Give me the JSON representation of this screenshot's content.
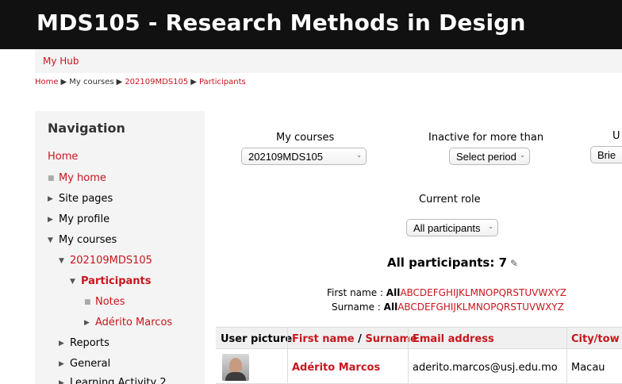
{
  "header": {
    "title": "MDS105 - Research Methods in Design"
  },
  "navbar": {
    "my_hub": "My Hub"
  },
  "breadcrumb": {
    "items": [
      "Home",
      "My courses",
      "202109MDS105",
      "Participants"
    ],
    "separator": "▶"
  },
  "navigation": {
    "title": "Navigation",
    "items": [
      {
        "label": "Home"
      },
      {
        "label": "My home"
      },
      {
        "label": "Site pages"
      },
      {
        "label": "My profile"
      },
      {
        "label": "My courses"
      },
      {
        "label": "202109MDS105"
      },
      {
        "label": "Participants"
      },
      {
        "label": "Notes"
      },
      {
        "label": "Adérito Marcos"
      },
      {
        "label": "Reports"
      },
      {
        "label": "General"
      },
      {
        "label": "Learning Activity 2"
      }
    ]
  },
  "filters": {
    "my_courses_label": "My courses",
    "my_courses_value": "202109MDS105",
    "inactive_label": "Inactive for more than",
    "inactive_value": "Select period",
    "third_label": "U",
    "third_value": "Brie",
    "role_label": "Current role",
    "role_value": "All participants"
  },
  "participants_heading": "All participants: 7",
  "initials": {
    "first_name_label": "First name :",
    "surname_label": "Surname :",
    "all": "All",
    "letters": "ABCDEFGHIJKLMNOPQRSTUVWXYZ"
  },
  "table": {
    "headers": {
      "user_picture": "User picture",
      "first_name": "First name",
      "slash": " / ",
      "surname": "Surname",
      "email": "Email address",
      "city": "City/tow"
    },
    "rows": [
      {
        "name": "Adérito Marcos",
        "email": "aderito.marcos@usj.edu.mo",
        "city": "Macau"
      }
    ]
  },
  "colors": {
    "accent": "#c8161d",
    "header_bg": "#111111",
    "panel_bg": "#f4f4f4"
  }
}
